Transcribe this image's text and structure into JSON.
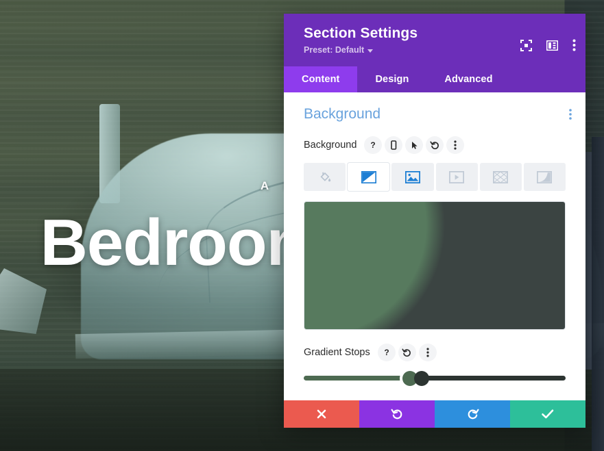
{
  "page": {
    "hero_eyebrow": "A  HOME",
    "hero_title": "Bedroom Retreat",
    "bg_description": "bedroom-photo"
  },
  "modal": {
    "title": "Section Settings",
    "preset_label": "Preset: Default",
    "header_icons": [
      {
        "name": "focus-icon",
        "label": "Focus"
      },
      {
        "name": "layout-panel-icon",
        "label": "Layout"
      },
      {
        "name": "more-vertical-icon",
        "label": "More"
      }
    ],
    "tabs": [
      {
        "label": "Content",
        "active": true
      },
      {
        "label": "Design",
        "active": false
      },
      {
        "label": "Advanced",
        "active": false
      }
    ],
    "section": {
      "title": "Background",
      "kebab": "section-options"
    },
    "background_field": {
      "label": "Background",
      "controls": [
        {
          "name": "help-icon",
          "glyph": "?"
        },
        {
          "name": "responsive-phone-icon",
          "glyph": "phone"
        },
        {
          "name": "hover-cursor-icon",
          "glyph": "cursor"
        },
        {
          "name": "reset-icon",
          "glyph": "undo"
        },
        {
          "name": "more-vertical-icon",
          "glyph": "kebab"
        }
      ],
      "types": [
        {
          "name": "background-color",
          "icon": "paint-bucket-icon",
          "active": false
        },
        {
          "name": "background-gradient",
          "icon": "gradient-icon",
          "active": true
        },
        {
          "name": "background-image",
          "icon": "image-icon",
          "active": false
        },
        {
          "name": "background-video",
          "icon": "video-icon",
          "active": false
        },
        {
          "name": "background-pattern",
          "icon": "pattern-icon",
          "active": false
        },
        {
          "name": "background-mask",
          "icon": "mask-icon",
          "active": false
        }
      ]
    },
    "gradient_preview": {
      "type": "radial",
      "shape": "circle at 4% 18%",
      "stops": [
        {
          "color": "#577a5e",
          "position": 0
        },
        {
          "color": "#577a5e",
          "position": 41
        },
        {
          "color": "#3b4442",
          "position": 48
        },
        {
          "color": "#3b4442",
          "position": 100
        }
      ]
    },
    "gradient_stops_field": {
      "label": "Gradient Stops",
      "controls": [
        {
          "name": "help-icon",
          "glyph": "?"
        },
        {
          "name": "reset-icon",
          "glyph": "undo"
        },
        {
          "name": "more-vertical-icon",
          "glyph": "kebab"
        }
      ],
      "track": [
        {
          "color": "#4d6a51",
          "position": 0
        },
        {
          "color": "#4d6a51",
          "position": 40
        },
        {
          "color": "#2c3431",
          "position": 42
        },
        {
          "color": "#2c3431",
          "position": 100
        }
      ],
      "handles": [
        {
          "name": "gradient-stop-1",
          "color": "#4d6a51",
          "position": 40.5,
          "selected": true
        },
        {
          "name": "gradient-stop-2",
          "color": "#2c3431",
          "position": 45.0,
          "selected": false
        }
      ]
    },
    "footer": [
      {
        "name": "cancel-button",
        "icon": "close-icon",
        "color": "#eb5a4f"
      },
      {
        "name": "undo-button",
        "icon": "undo-icon",
        "color": "#8b33e2"
      },
      {
        "name": "redo-button",
        "icon": "redo-icon",
        "color": "#2d8fdd"
      },
      {
        "name": "save-button",
        "icon": "check-icon",
        "color": "#2dbf9a"
      }
    ]
  },
  "colors": {
    "header_purple": "#6c2eb9",
    "tab_active_purple": "#8e3ced",
    "section_blue": "#6aa3dd",
    "accent_blue": "#2d8fdd"
  }
}
